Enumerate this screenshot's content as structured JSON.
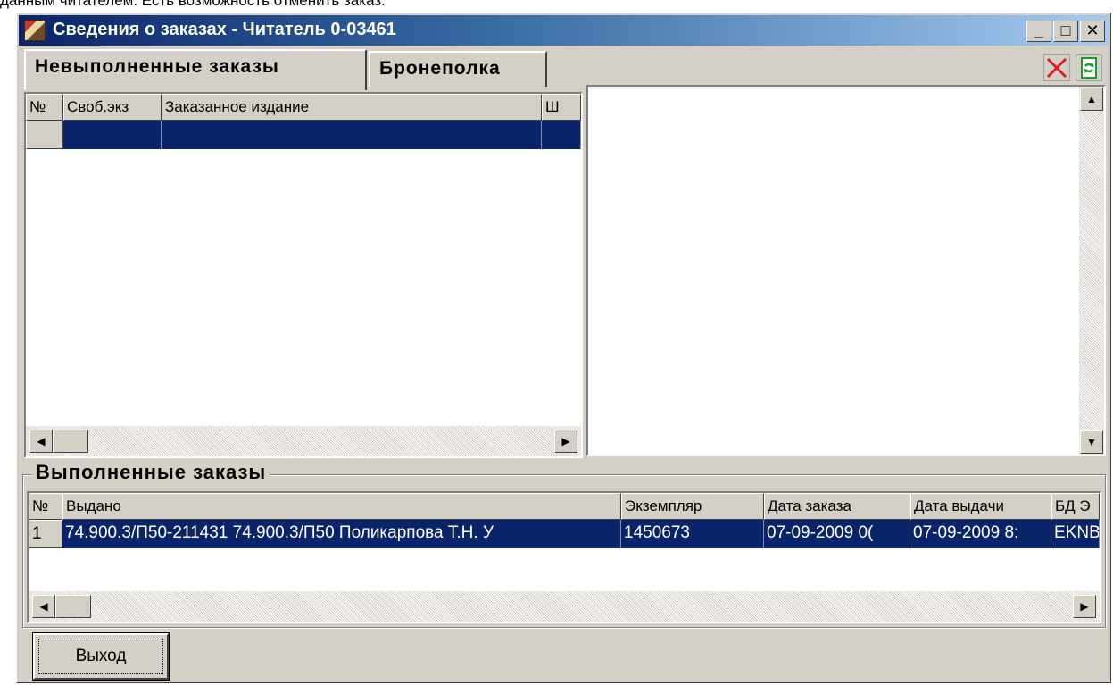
{
  "document": {
    "caption_text": "данным читателем. Есть возможность отменить заказ."
  },
  "window": {
    "title": "Сведения о заказах - Читатель 0-03461",
    "caption_buttons": {
      "minimize": "_",
      "maximize": "□",
      "close": "✕"
    }
  },
  "tabs": [
    {
      "label": "Невыполненные заказы",
      "active": true
    },
    {
      "label": "Бронеполка",
      "active": false
    }
  ],
  "toolbar": {
    "delete_icon": "red-x-icon",
    "refresh_icon": "refresh-icon",
    "delete_color": "#e02020",
    "refresh_color": "#1a9a2a"
  },
  "pending_orders": {
    "columns": [
      "№",
      "Своб.экз",
      "Заказанное издание",
      "Ш"
    ],
    "rows": [
      {
        "num": "",
        "free_copies": "",
        "title": "",
        "shelf": ""
      }
    ]
  },
  "completed_orders": {
    "group_title": "Выполненные заказы",
    "columns": [
      "№",
      "Выдано",
      "Экземпляр",
      "Дата заказа",
      "Дата выдачи",
      "БД Э"
    ],
    "rows": [
      {
        "num": "1",
        "issued": "74.900.3/П50-211431 74.900.3/П50   Поликарпова Т.Н. У",
        "copy": "1450673",
        "order_date": "07-09-2009  0(",
        "issue_date": "07-09-2009  8:",
        "db": "EKNB"
      }
    ]
  },
  "buttons": {
    "exit": "Выход"
  },
  "colors": {
    "title_bar_start": "#0a246a",
    "title_bar_end": "#a6caf0",
    "selection": "#0a246a",
    "face": "#d4d0c8"
  }
}
